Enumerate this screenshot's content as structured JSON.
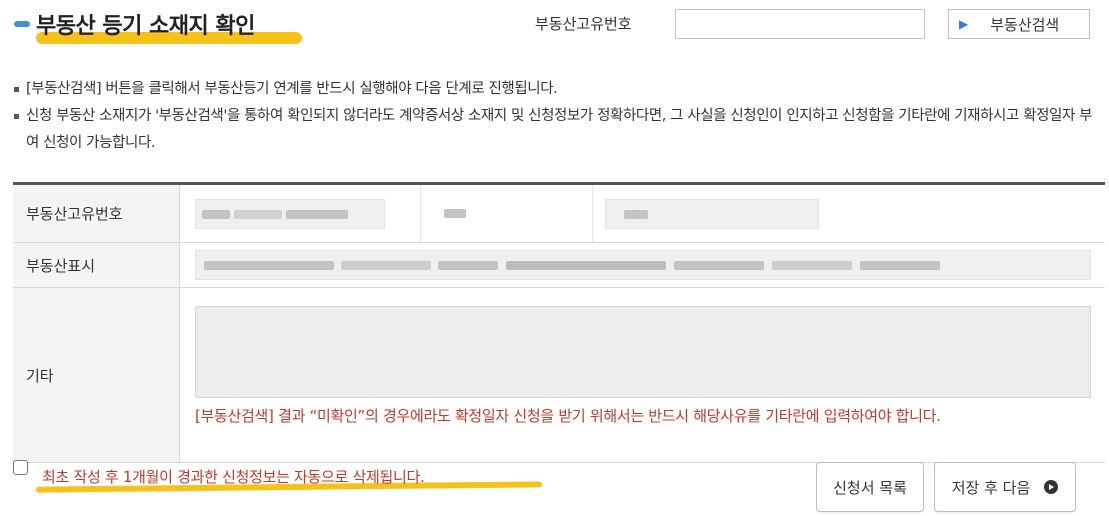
{
  "header": {
    "title": "부동산 등기 소재지 확인",
    "uid_label": "부동산고유번호",
    "uid_value": "",
    "search_button": "부동산검색"
  },
  "notes": [
    "[부동산검색] 버튼을 클릭해서 부동산등기 연계를 반드시 실행해야 다음 단계로 진행됩니다.",
    "신청 부동산 소재지가 '부동산검색'을 통하여 확인되지 않더라도 계약증서상 소재지 및 신청정보가 정확하다면, 그 사실을 신청인이 인지하고 신청함을 기타란에 기재하시고 확정일자 부여 신청이 가능합니다."
  ],
  "table": {
    "uid_header": "부동산고유번호",
    "display_header": "부동산표시",
    "etc_header": "기타",
    "etc_value": "",
    "warning": "[부동산검색] 결과 “미확인”의 경우에라도 확정일자 신청을 받기 위해서는 반드시 해당사유를 기타란에 입력하여야 합니다."
  },
  "footer": {
    "delete_notice": "최초 작성 후 1개월이 경과한 신청정보는 자동으로 삭제됩니다.",
    "list_button": "신청서 목록",
    "next_button": "저장 후 다음"
  },
  "icons": {
    "search_button_icon": "chevron-right-icon",
    "next_button_icon": "circle-arrow-right-icon"
  },
  "colors": {
    "accent_blue": "#3e8fd6",
    "highlight_yellow": "#f5c21b",
    "warning_red": "#c0392b",
    "table_border": "#555555"
  }
}
